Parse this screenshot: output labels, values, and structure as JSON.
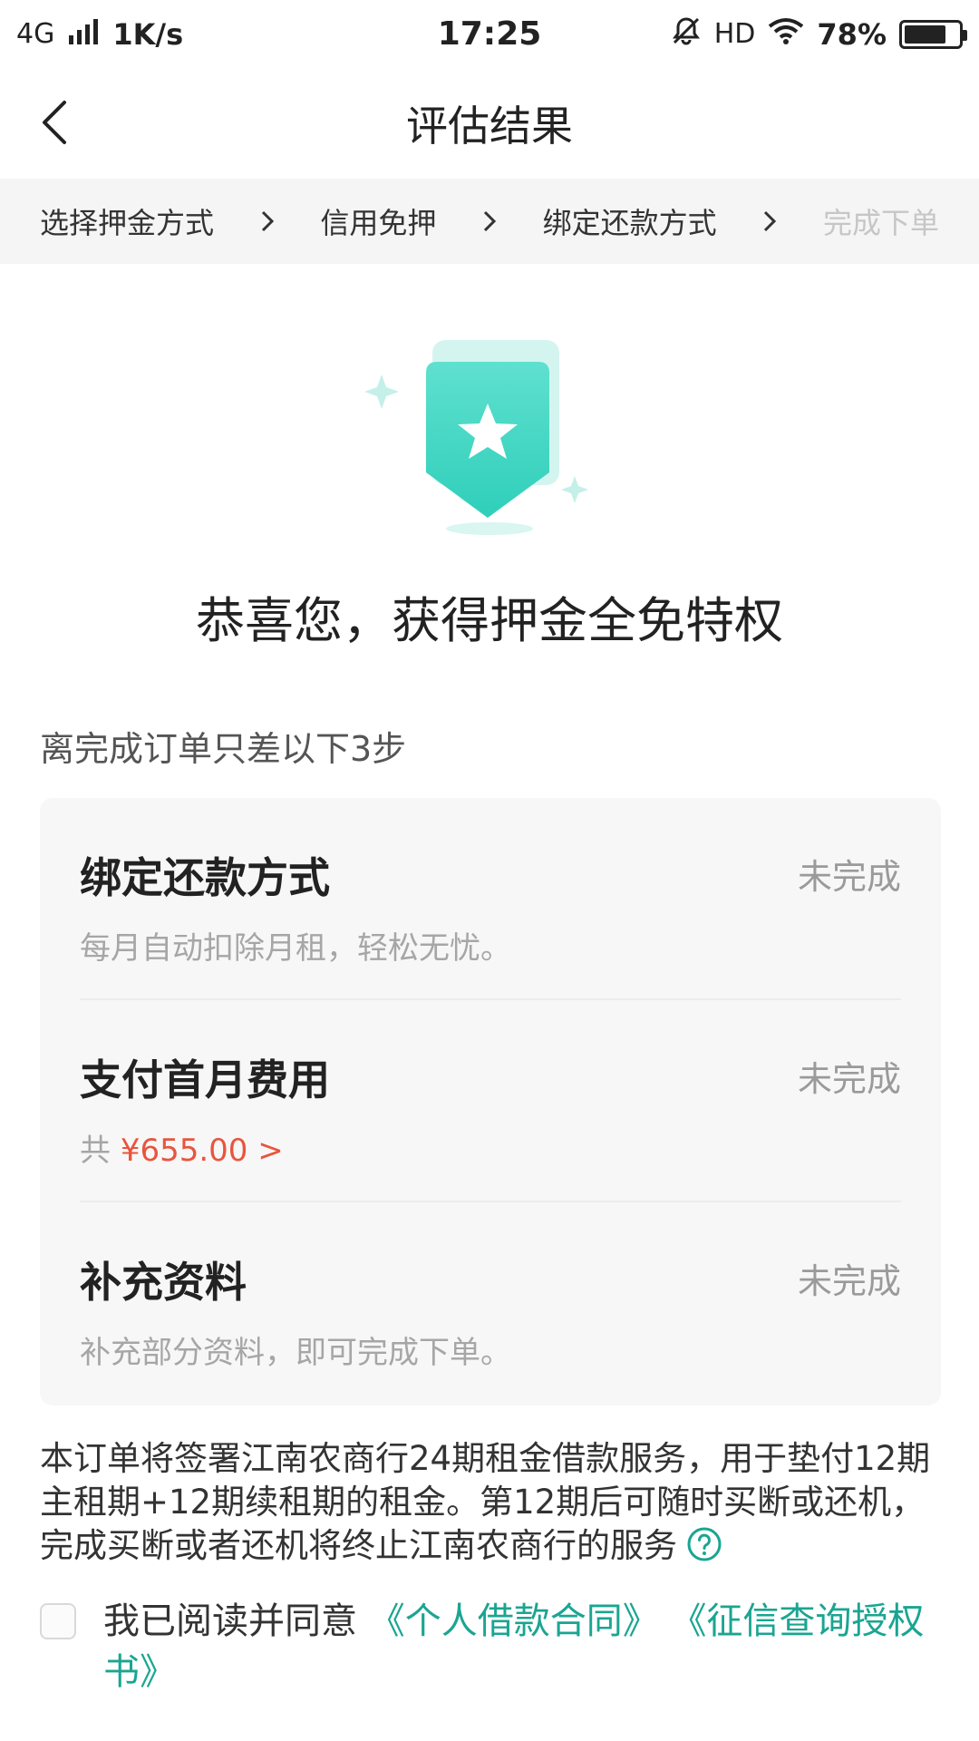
{
  "status_bar": {
    "network": "4G",
    "speed": "1K/s",
    "time": "17:25",
    "hd": "HD",
    "battery": "78%",
    "battery_level": 0.78
  },
  "nav": {
    "title": "评估结果"
  },
  "steps": [
    {
      "label": "选择押金方式"
    },
    {
      "label": "信用免押"
    },
    {
      "label": "绑定还款方式"
    },
    {
      "label": "完成下单"
    }
  ],
  "hero": {
    "title": "恭喜您，获得押金全免特权"
  },
  "remaining": {
    "text": "离完成订单只差以下3步"
  },
  "tasks": [
    {
      "title": "绑定还款方式",
      "status": "未完成",
      "desc": "每月自动扣除月租，轻松无忧。"
    },
    {
      "title": "支付首月费用",
      "status": "未完成",
      "desc_prefix": "共",
      "price": "¥655.00 >"
    },
    {
      "title": "补充资料",
      "status": "未完成",
      "desc": "补充部分资料，即可完成下单。"
    }
  ],
  "notice": {
    "text": "本订单将签署江南农商行24期租金借款服务，用于垫付12期主租期+12期续租期的租金。第12期后可随时买断或还机，完成买断或者还机将终止江南农商行的服务"
  },
  "agreement": {
    "prefix": "我已阅读并同意",
    "link1": "《个人借款合同》",
    "link2": "《征信查询授权书》"
  },
  "colors": {
    "accent": "#1aa592",
    "price": "#e8553e",
    "badge": "#3fd6c3"
  }
}
